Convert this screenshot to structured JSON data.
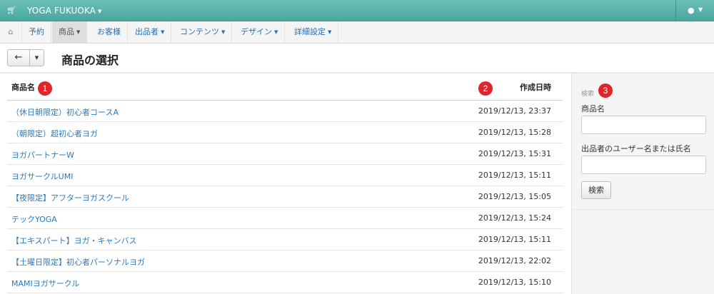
{
  "header": {
    "brand": "YOGA FUKUOKA",
    "cart_icon": "shopping-cart-icon",
    "user_icon": "user-icon"
  },
  "nav": {
    "home_icon": "home-icon",
    "items": [
      {
        "label": "予約",
        "dropdown": false
      },
      {
        "label": "商品",
        "dropdown": true,
        "active": true
      },
      {
        "label": "お客様",
        "dropdown": false
      },
      {
        "label": "出品者",
        "dropdown": true
      },
      {
        "label": "コンテンツ",
        "dropdown": true
      },
      {
        "label": "デザイン",
        "dropdown": true
      },
      {
        "label": "詳細設定",
        "dropdown": true
      }
    ]
  },
  "page": {
    "title": "商品の選択"
  },
  "table": {
    "columns": [
      "商品名",
      "作成日時"
    ],
    "rows": [
      {
        "name": "（休日朝限定）初心者コースA",
        "created": "2019/12/13, 23:37"
      },
      {
        "name": "（朝限定）超初心者ヨガ",
        "created": "2019/12/13, 15:28"
      },
      {
        "name": "ヨガパートナーW",
        "created": "2019/12/13, 15:31"
      },
      {
        "name": "ヨガサークルUMI",
        "created": "2019/12/13, 15:11"
      },
      {
        "name": "【夜限定】アフターヨガスクール",
        "created": "2019/12/13, 15:05"
      },
      {
        "name": "テックYOGA",
        "created": "2019/12/13, 15:24"
      },
      {
        "name": "【エキスパート】ヨガ・キャンバス",
        "created": "2019/12/13, 15:11"
      },
      {
        "name": "【土曜日限定】初心者パーソナルヨガ",
        "created": "2019/12/13, 22:02"
      },
      {
        "name": "MAMIヨガサークル",
        "created": "2019/12/13, 15:10"
      }
    ]
  },
  "sidebar": {
    "heading": "検索",
    "field1_label": "商品名",
    "field1_value": "",
    "field2_label": "出品者のユーザー名または氏名",
    "field2_value": "",
    "search_button": "検索"
  },
  "badges": [
    "1",
    "2",
    "3"
  ],
  "colors": {
    "header_bg": "#4aa69d",
    "link": "#2a7bbf",
    "badge": "#e0242b"
  }
}
